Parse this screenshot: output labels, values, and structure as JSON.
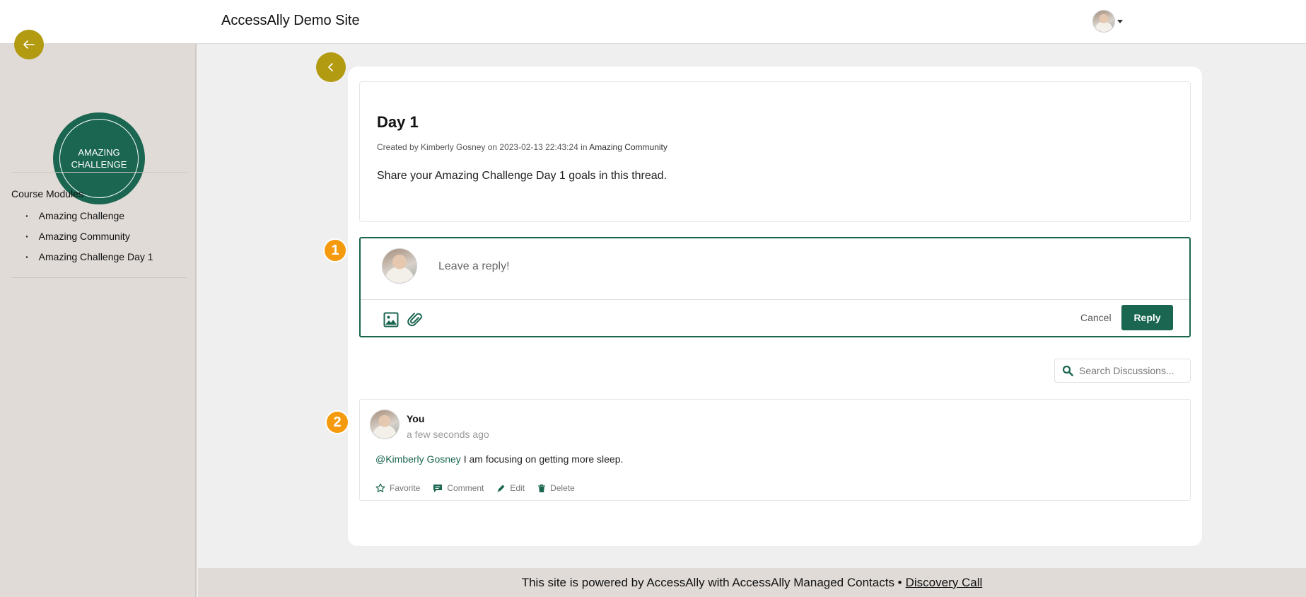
{
  "header": {
    "site_title": "AccessAlly Demo Site"
  },
  "sidebar": {
    "logo_line1": "AMAZING",
    "logo_line2": "CHALLENGE",
    "modules_title": "Course Modules",
    "modules": [
      {
        "label": "Amazing Challenge"
      },
      {
        "label": "Amazing Community"
      },
      {
        "label": "Amazing Challenge Day 1"
      }
    ]
  },
  "post": {
    "title": "Day 1",
    "meta_prefix": "Created by Kimberly Gosney on 2023-02-13 22:43:24 in",
    "community": "Amazing Community",
    "body": "Share your Amazing Challenge Day 1 goals in this thread."
  },
  "steps": {
    "one": "1",
    "two": "2"
  },
  "reply": {
    "placeholder": "Leave a reply!",
    "cancel_label": "Cancel",
    "submit_label": "Reply"
  },
  "search": {
    "placeholder": "Search Discussions..."
  },
  "comment": {
    "author": "You",
    "time": "a few seconds ago",
    "mention": "@Kimberly Gosney",
    "text": " I am focusing on getting more sleep.",
    "actions": {
      "favorite": "Favorite",
      "comment": "Comment",
      "edit": "Edit",
      "delete": "Delete"
    }
  },
  "footer": {
    "text": "This site is powered by AccessAlly with AccessAlly Managed Contacts •",
    "link": "Discovery Call"
  },
  "colors": {
    "brand_green": "#1a6650",
    "gold": "#b29a11",
    "step_orange": "#f59a0c",
    "sidebar_bg": "#e0dbd7"
  },
  "icons": [
    "back-arrow-icon",
    "chevron-left-icon",
    "caret-down-icon",
    "image-icon",
    "paperclip-icon",
    "search-icon",
    "star-icon",
    "comment-icon",
    "pencil-icon",
    "trash-icon"
  ]
}
